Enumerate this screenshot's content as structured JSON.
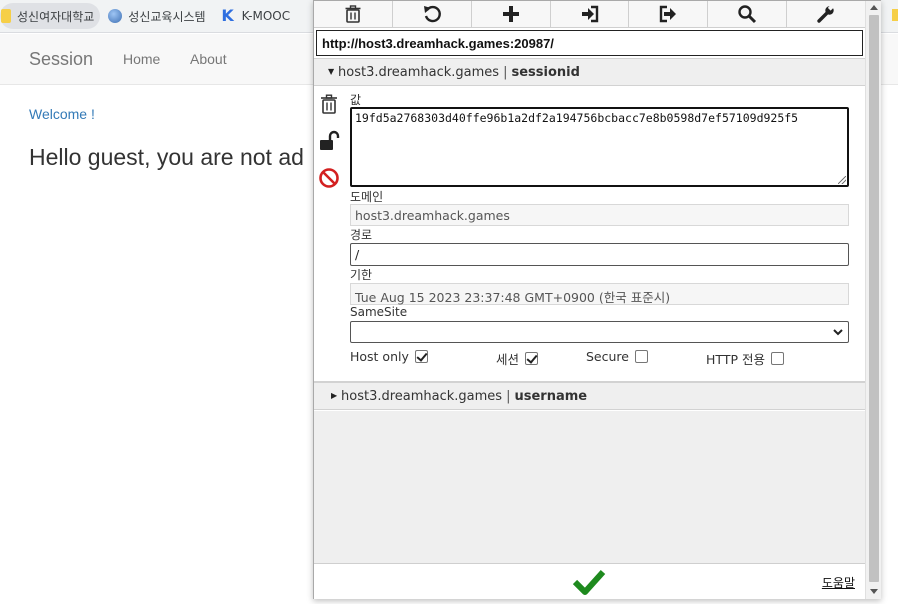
{
  "bookmarks": [
    {
      "label": "성신여자대학교",
      "icon": "folder-icon"
    },
    {
      "label": "성신교육시스템",
      "icon": "globe-icon"
    },
    {
      "label": "K-MOOC",
      "icon": "k-logo-icon"
    }
  ],
  "site": {
    "brand": "Session",
    "nav": [
      "Home",
      "About"
    ],
    "welcome": "Welcome !",
    "hello": "Hello guest, you are not ad"
  },
  "editor": {
    "toolbar": [
      {
        "name": "delete-all",
        "icon": "trash-icon"
      },
      {
        "name": "reset",
        "icon": "undo-icon"
      },
      {
        "name": "add",
        "icon": "plus-icon"
      },
      {
        "name": "import",
        "icon": "import-icon"
      },
      {
        "name": "export",
        "icon": "export-icon"
      },
      {
        "name": "search",
        "icon": "search-icon"
      },
      {
        "name": "settings",
        "icon": "wrench-icon"
      }
    ],
    "url": "http://host3.dreamhack.games:20987/",
    "cookies": [
      {
        "domain": "host3.dreamhack.games",
        "separator": "|",
        "name": "sessionid",
        "expanded": true
      },
      {
        "domain": "host3.dreamhack.games",
        "separator": "|",
        "name": "username",
        "expanded": false
      }
    ],
    "detail": {
      "value_label": "값",
      "value": "19fd5a2768303d40ffe96b1a2df2a194756bcbacc7e8b0598d7ef57109d925f5",
      "domain_label": "도메인",
      "domain": "host3.dreamhack.games",
      "path_label": "경로",
      "path": "/",
      "expires_label": "기한",
      "expires": "Tue Aug 15 2023 23:37:48 GMT+0900 (한국 표준시)",
      "samesite_label": "SameSite",
      "samesite": "",
      "flags": [
        {
          "label": "Host only",
          "checked": true
        },
        {
          "label": "세션",
          "checked": true
        },
        {
          "label": "Secure",
          "checked": false
        },
        {
          "label": "HTTP 전용",
          "checked": false
        }
      ]
    },
    "help": "도움말",
    "colors": {
      "accent_ok": "#1e8a1e",
      "block_red": "#d32020"
    }
  }
}
